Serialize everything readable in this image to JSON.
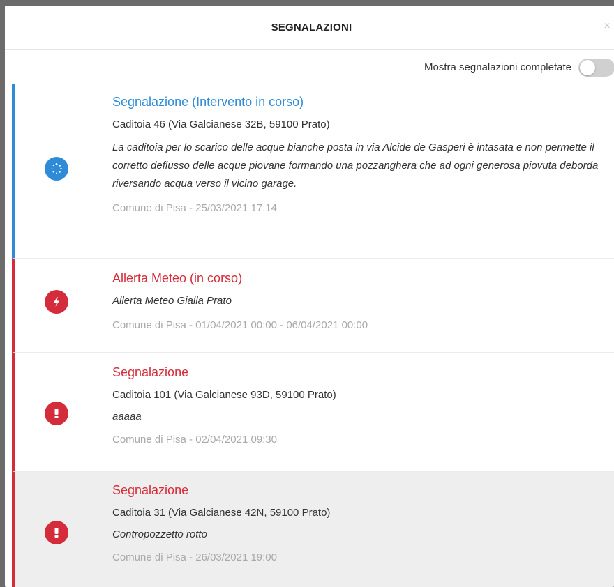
{
  "modal": {
    "title": "SEGNALAZIONI",
    "close_icon": "×"
  },
  "toggle": {
    "label": "Mostra segnalazioni completate",
    "state": "off"
  },
  "cards": [
    {
      "status": "in-progress",
      "accent": "#2f8bd8",
      "icon": "spinner-icon",
      "title": "Segnalazione (Intervento in corso)",
      "address": "Caditoia 46 (Via Galcianese 32B, 59100 Prato)",
      "description": "La caditoia per lo scarico delle acque bianche posta in via Alcide de Gasperi è intasata e non permette il corretto deflusso delle acque piovane formando una pozzanghera che ad ogni generosa piovuta deborda riversando acqua verso il vicino garage.",
      "meta": "Comune di Pisa - 25/03/2021 17:14"
    },
    {
      "status": "alert",
      "accent": "#d42c3b",
      "icon": "lightning-icon",
      "title": "Allerta Meteo (in corso)",
      "description": "Allerta Meteo Gialla Prato",
      "meta": "Comune di Pisa - 01/04/2021 00:00 - 06/04/2021 00:00"
    },
    {
      "status": "open",
      "accent": "#d42c3b",
      "icon": "exclamation-icon",
      "title": "Segnalazione",
      "address": "Caditoia 101 (Via Galcianese 93D, 59100 Prato)",
      "description": "aaaaa",
      "meta": "Comune di Pisa - 02/04/2021 09:30"
    },
    {
      "status": "open",
      "accent": "#d42c3b",
      "icon": "exclamation-icon",
      "title": "Segnalazione",
      "address": "Caditoia 31 (Via Galcianese 42N, 59100 Prato)",
      "description": "Contropozzetto rotto",
      "meta": "Comune di Pisa - 26/03/2021 19:00"
    }
  ]
}
